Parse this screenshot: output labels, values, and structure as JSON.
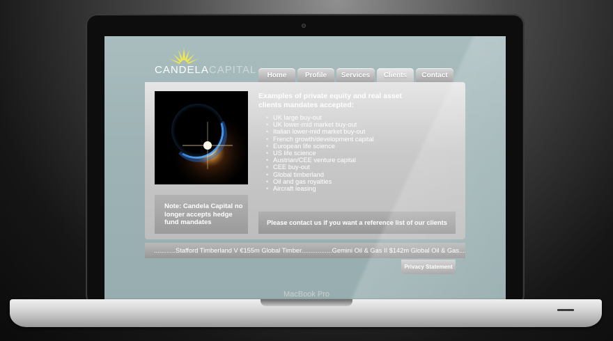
{
  "device": {
    "label": "MacBook Pro"
  },
  "logo": {
    "word1": "CANDELA",
    "word2": "CAPITAL"
  },
  "nav": [
    "Home",
    "Profile",
    "Services",
    "Clients",
    "Contact"
  ],
  "colors": {
    "screen_bg": "#9eb3b5",
    "panel": "#d4d4d4",
    "logo_rays": "#f2e84a",
    "text": "#ffffff"
  },
  "main": {
    "heading": "Examples of private equity and real asset clients mandates accepted:",
    "mandates": [
      "UK large buy-out",
      "UK lower-mid market buy-out",
      "Italian lower-mid market buy-out",
      "French growth/development capital",
      "European life science",
      "US life science",
      "Austrian/CEE venture capital",
      "CEE buy-out",
      "Global timberland",
      "Oil and gas royalties",
      "Aircraft leasing"
    ],
    "note": "Note: Candela Capital no longer accepts hedge fund mandates",
    "contact": "Please contact us if you want a reference list of our clients"
  },
  "ticker": "............Stafford Timberland V €155m Global Timber.................Gemini Oil & Gas II $142m Global Oil & Gas..............",
  "footer": {
    "privacy": "Privacy Statement"
  }
}
